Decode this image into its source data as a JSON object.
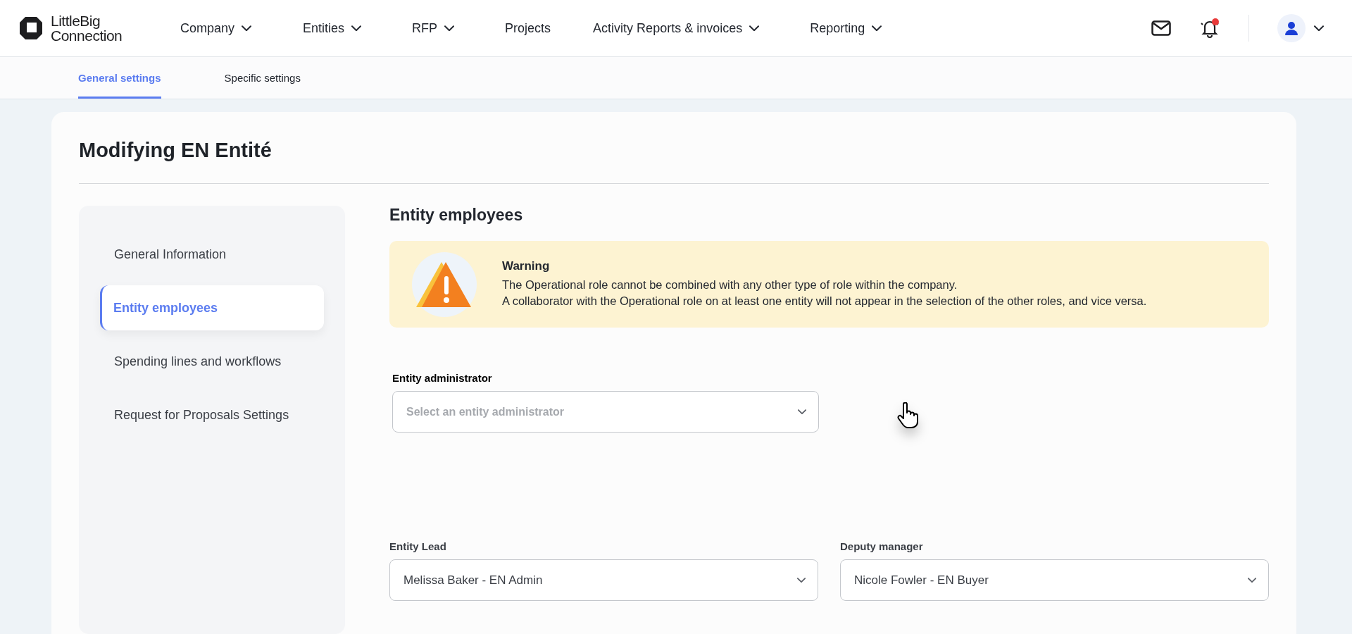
{
  "logo": {
    "line1": "LittleBig",
    "line2": "Connection"
  },
  "nav": [
    {
      "label": "Company",
      "dropdown": true
    },
    {
      "label": "Entities",
      "dropdown": true
    },
    {
      "label": "RFP",
      "dropdown": true
    },
    {
      "label": "Projects",
      "dropdown": false
    },
    {
      "label": "Activity Reports & invoices",
      "dropdown": true
    },
    {
      "label": "Reporting",
      "dropdown": true
    }
  ],
  "header_icons": {
    "notification_dot": true
  },
  "subtabs": [
    {
      "label": "General settings",
      "selected": true
    },
    {
      "label": "Specific settings",
      "selected": false
    }
  ],
  "page_title": "Modifying EN Entité",
  "sidebar": [
    {
      "label": "General Information",
      "selected": false
    },
    {
      "label": "Entity employees",
      "selected": true
    },
    {
      "label": "Spending lines and workflows",
      "selected": false
    },
    {
      "label": "Request for Proposals Settings",
      "selected": false
    }
  ],
  "section_title": "Entity employees",
  "warning": {
    "title": "Warning",
    "lines": [
      "The Operational role cannot be combined with any other type of role within the company.",
      "A collaborator with the Operational role on at least one entity will not appear in the selection of the other roles, and vice versa."
    ]
  },
  "admin_field": {
    "label": "Entity administrator",
    "placeholder": "Select an entity administrator"
  },
  "fields": [
    {
      "label": "Entity Lead",
      "value": "Melissa Baker - EN Admin"
    },
    {
      "label": "Deputy manager",
      "value": "Nicole Fowler - EN Buyer"
    }
  ]
}
